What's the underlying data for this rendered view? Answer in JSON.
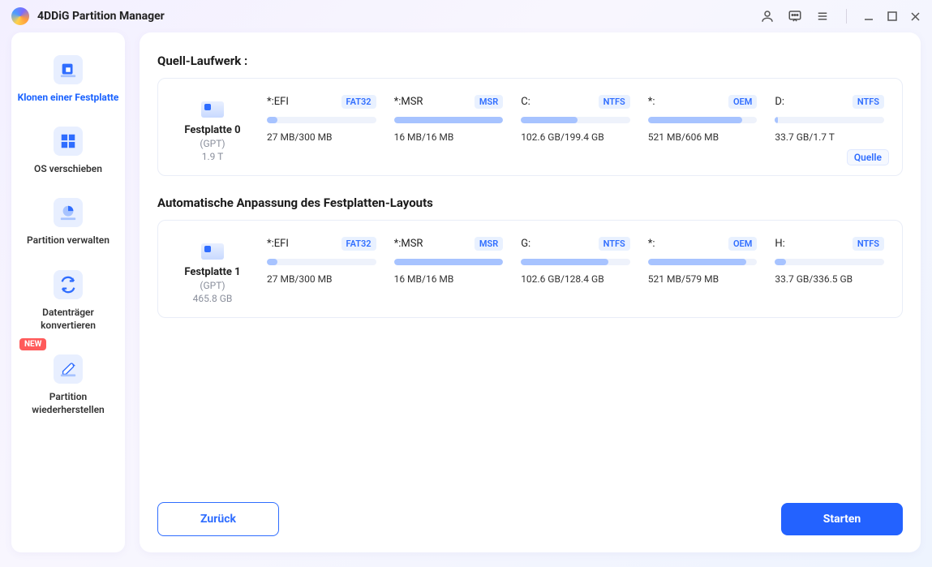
{
  "app": {
    "title": "4DDiG Partition Manager"
  },
  "sidebar": {
    "items": [
      {
        "label": "Klonen einer Festplatte",
        "active": true
      },
      {
        "label": "OS verschieben"
      },
      {
        "label": "Partition verwalten"
      },
      {
        "label": "Datenträger konvertieren"
      },
      {
        "label": "Partition wiederherstellen",
        "badge": "NEW"
      }
    ]
  },
  "section1_title": "Quell-Laufwerk :",
  "section2_title": "Automatische Anpassung des Festplatten-Layouts",
  "source_tag": "Quelle",
  "disk1": {
    "name": "Festplatte 0",
    "scheme": "(GPT)",
    "capacity": "1.9 T",
    "partitions": [
      {
        "label": "*:EFI",
        "fs": "FAT32",
        "size": "27 MB/300 MB",
        "fill": 10
      },
      {
        "label": "*:MSR",
        "fs": "MSR",
        "size": "16 MB/16 MB",
        "fill": 100
      },
      {
        "label": "C:",
        "fs": "NTFS",
        "size": "102.6 GB/199.4 GB",
        "fill": 52
      },
      {
        "label": "*:",
        "fs": "OEM",
        "size": "521 MB/606 MB",
        "fill": 86
      },
      {
        "label": "D:",
        "fs": "NTFS",
        "size": "33.7 GB/1.7 T",
        "fill": 3
      }
    ]
  },
  "disk2": {
    "name": "Festplatte 1",
    "scheme": "(GPT)",
    "capacity": "465.8 GB",
    "partitions": [
      {
        "label": "*:EFI",
        "fs": "FAT32",
        "size": "27 MB/300 MB",
        "fill": 10
      },
      {
        "label": "*:MSR",
        "fs": "MSR",
        "size": "16 MB/16 MB",
        "fill": 100
      },
      {
        "label": "G:",
        "fs": "NTFS",
        "size": "102.6 GB/128.4 GB",
        "fill": 80
      },
      {
        "label": "*:",
        "fs": "OEM",
        "size": "521 MB/579 MB",
        "fill": 90
      },
      {
        "label": "H:",
        "fs": "NTFS",
        "size": "33.7 GB/336.5 GB",
        "fill": 10
      }
    ]
  },
  "footer": {
    "back": "Zurück",
    "start": "Starten"
  }
}
